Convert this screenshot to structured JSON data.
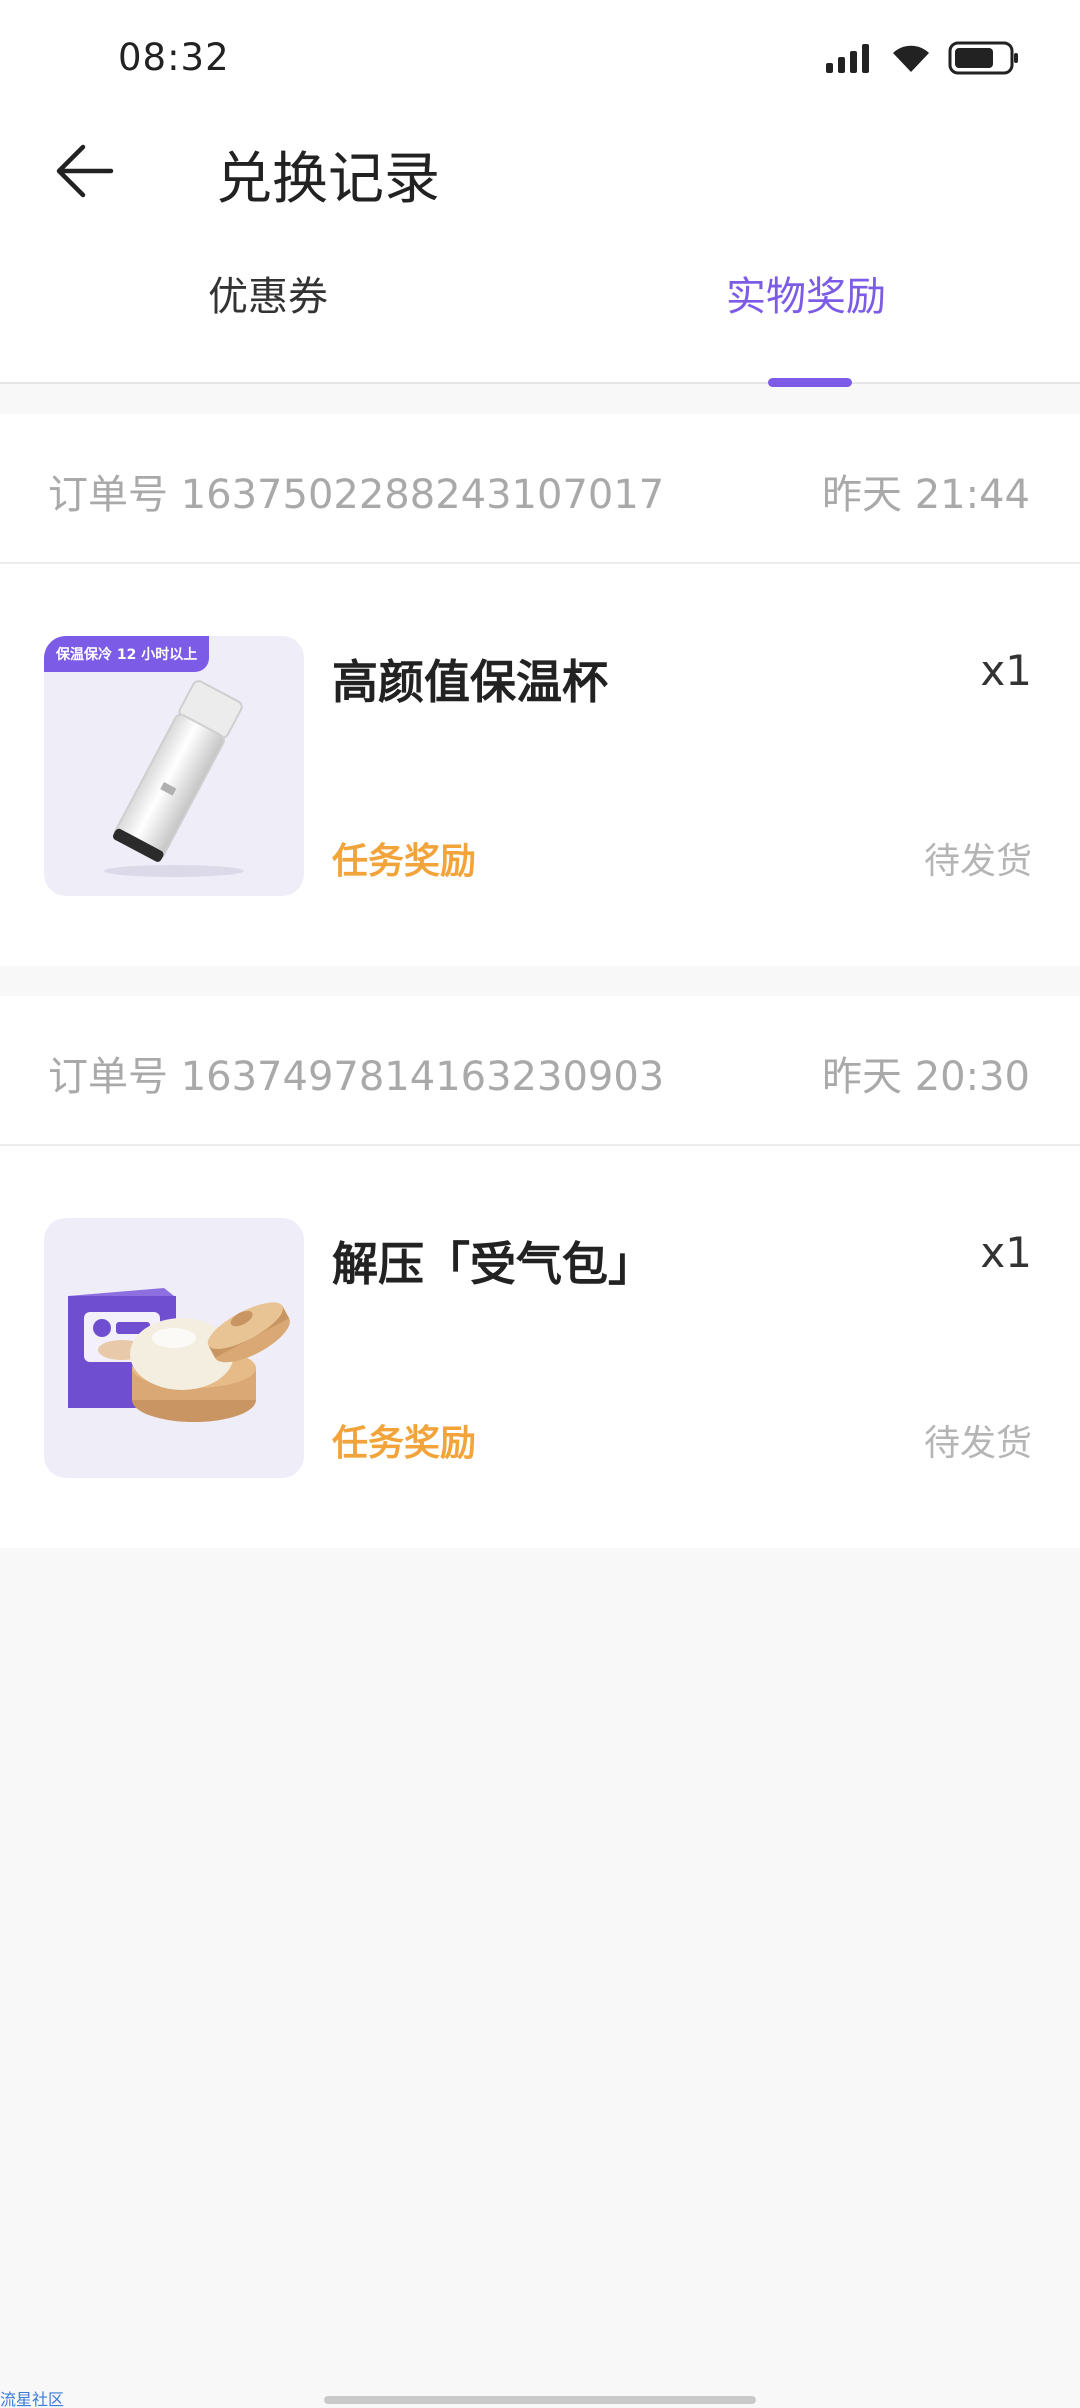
{
  "status_bar": {
    "time": "08:32",
    "icons": [
      "signal-icon",
      "wifi-icon",
      "battery-icon"
    ]
  },
  "header": {
    "back_icon": "arrow-left-icon",
    "title": "兑换记录"
  },
  "tabs": [
    {
      "label": "优惠券",
      "active": false
    },
    {
      "label": "实物奖励",
      "active": true
    }
  ],
  "colors": {
    "accent": "#7c5ce6",
    "source_text": "#f2a33a",
    "muted_text": "#a9a9a9"
  },
  "orders": [
    {
      "order_no": "订单号 1637502288243107017",
      "time": "昨天 21:44",
      "item": {
        "image_badge": "保温保冷 12 小时以上",
        "image_icon": "thermos-bottle-icon",
        "name": "高颜值保温杯",
        "quantity": "x1",
        "source": "任务奖励",
        "status": "待发货"
      }
    },
    {
      "order_no": "订单号 1637497814163230903",
      "time": "昨天 20:30",
      "item": {
        "image_icon": "steamed-bun-toy-icon",
        "name": "解压「受气包」",
        "quantity": "x1",
        "source": "任务奖励",
        "status": "待发货"
      }
    }
  ],
  "watermark": "流星社区"
}
